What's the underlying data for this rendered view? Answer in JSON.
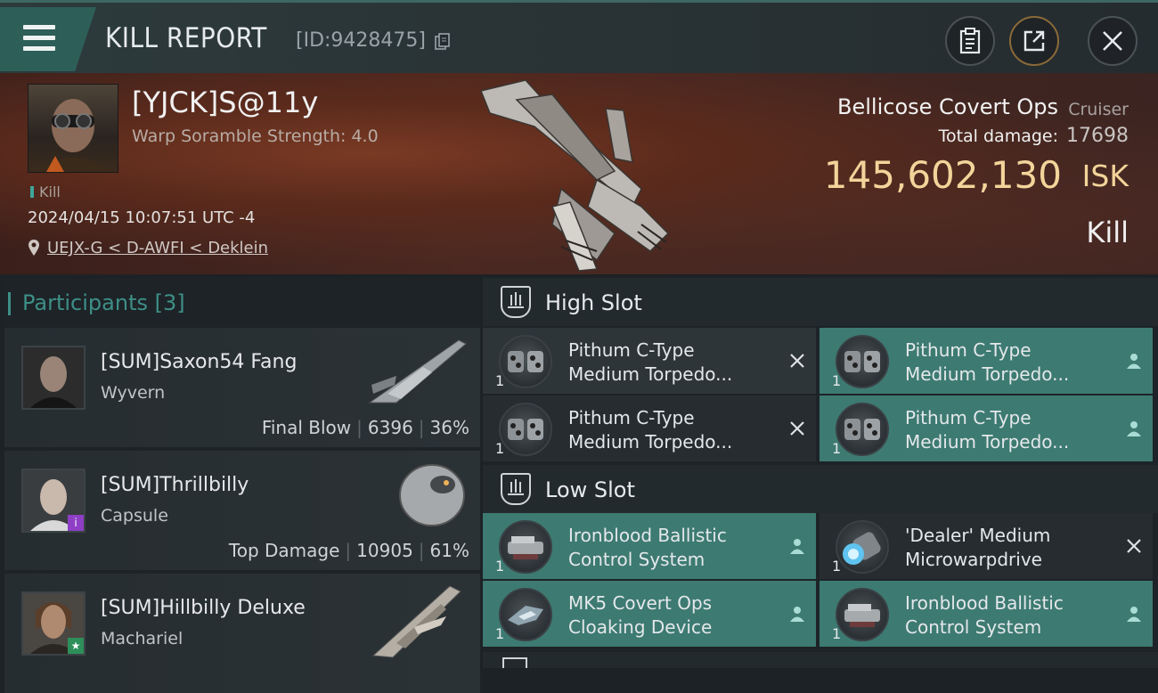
{
  "header": {
    "title": "KILL REPORT",
    "report_id": "[ID:9428475]"
  },
  "victim": {
    "name": "[YJCK]S@11y",
    "scramble": "Warp Soramble Strength: 4.0",
    "tag": "Kill",
    "datetime": "2024/04/15 10:07:51 UTC -4",
    "location": "UEJX-G < D-AWFI < Deklein",
    "ship_name": "Bellicose Covert Ops",
    "ship_class": "Cruiser",
    "total_damage_label": "Total damage:",
    "total_damage": "17698",
    "isk_value": "145,602,130",
    "isk_unit": "ISK",
    "result": "Kill"
  },
  "participants": {
    "title": "Participants",
    "count": "[3]",
    "items": [
      {
        "name": "[SUM]Saxon54 Fang",
        "ship": "Wyvern",
        "role": "Final Blow",
        "damage": "6396",
        "percent": "36%"
      },
      {
        "name": "[SUM]Thrillbilly",
        "ship": "Capsule",
        "role": "Top Damage",
        "damage": "10905",
        "percent": "61%"
      },
      {
        "name": "[SUM]Hillbilly Deluxe",
        "ship": "Machariel",
        "role": "",
        "damage": "",
        "percent": ""
      }
    ]
  },
  "fitting": {
    "high_slot_label": "High Slot",
    "low_slot_label": "Low Slot",
    "high": [
      {
        "qty": "1",
        "line1": "Pithum C-Type",
        "line2": "Medium Torpedo...",
        "status": "destroyed"
      },
      {
        "qty": "1",
        "line1": "Pithum C-Type",
        "line2": "Medium Torpedo...",
        "status": "dropped"
      },
      {
        "qty": "1",
        "line1": "Pithum C-Type",
        "line2": "Medium Torpedo...",
        "status": "destroyed"
      },
      {
        "qty": "1",
        "line1": "Pithum C-Type",
        "line2": "Medium Torpedo...",
        "status": "dropped"
      }
    ],
    "low": [
      {
        "qty": "1",
        "line1": "Ironblood Ballistic",
        "line2": "Control System",
        "status": "dropped"
      },
      {
        "qty": "1",
        "line1": "'Dealer' Medium",
        "line2": "Microwarpdrive",
        "status": "destroyed"
      },
      {
        "qty": "1",
        "line1": "MK5 Covert Ops",
        "line2": "Cloaking Device",
        "status": "dropped"
      },
      {
        "qty": "1",
        "line1": "Ironblood Ballistic",
        "line2": "Control System",
        "status": "dropped"
      }
    ]
  },
  "colors": {
    "accent": "#3e8f87",
    "isk": "#f3d49a",
    "teal_row": "#3d7a72"
  }
}
